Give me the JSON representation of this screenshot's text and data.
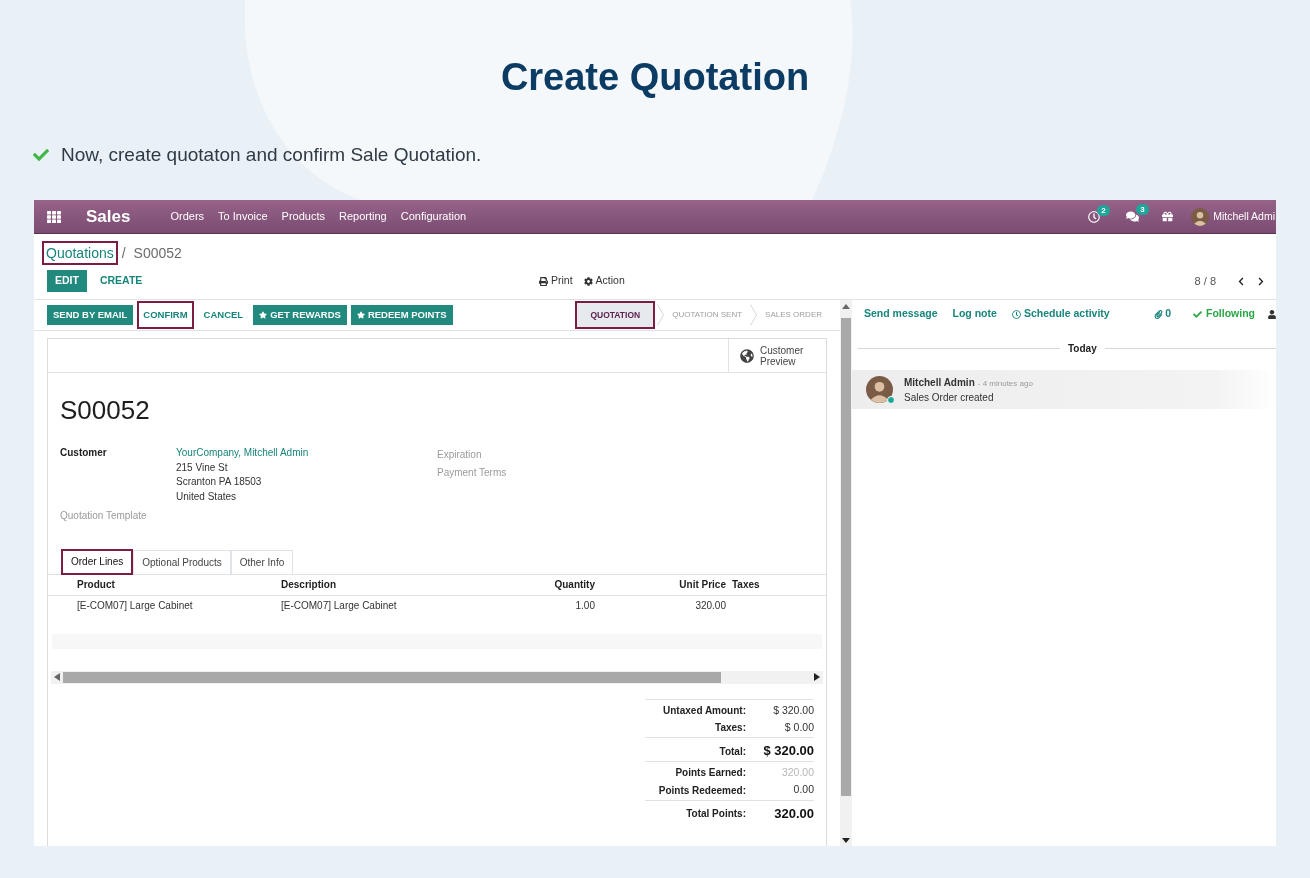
{
  "page": {
    "title": "Create Quotation",
    "note": "Now, create quotaton and confirm Sale Quotation."
  },
  "navbar": {
    "app": "Sales",
    "menu": [
      "Orders",
      "To Invoice",
      "Products",
      "Reporting",
      "Configuration"
    ],
    "activities_badge": "2",
    "messages_badge": "3",
    "user": "Mitchell Admi"
  },
  "breadcrumb": {
    "items": [
      {
        "label": "Quotations",
        "kind": "link",
        "highlighted": true
      },
      {
        "label": "S00052",
        "kind": "current",
        "highlighted": false
      }
    ],
    "separator": "/"
  },
  "toolbar": {
    "buttons": [
      {
        "label": "EDIT",
        "kind": "primary"
      },
      {
        "label": "CREATE",
        "kind": "link"
      }
    ],
    "actions": [
      "Print",
      "Action"
    ],
    "pager": "8 / 8"
  },
  "header": {
    "buttons": [
      {
        "label": "SEND BY EMAIL",
        "kind": "primary",
        "highlighted": false
      },
      {
        "label": "CONFIRM",
        "kind": "link",
        "highlighted": true
      },
      {
        "label": "CANCEL",
        "kind": "link",
        "highlighted": false
      },
      {
        "label": "GET REWARDS",
        "kind": "reward",
        "highlighted": false
      },
      {
        "label": "REDEEM POINTS",
        "kind": "reward",
        "highlighted": false
      }
    ],
    "statuses": [
      {
        "label": "QUOTATION",
        "selected": true,
        "highlighted": true
      },
      {
        "label": "QUOTATION SENT",
        "selected": false,
        "highlighted": false
      },
      {
        "label": "SALES ORDER",
        "selected": false,
        "highlighted": false
      }
    ]
  },
  "form": {
    "smart_button": "Customer Preview",
    "name": "S00052",
    "left_fields": [
      {
        "label": "Customer",
        "required": true,
        "link": "YourCompany, Mitchell Admin",
        "lines": [
          "215 Vine St",
          "Scranton PA 18503",
          "United States"
        ]
      },
      {
        "label": "Quotation Template",
        "required": false
      }
    ],
    "right_fields": [
      {
        "label": "Expiration",
        "required": false
      },
      {
        "label": "Payment Terms",
        "required": false
      }
    ]
  },
  "tabs": [
    {
      "label": "Order Lines",
      "selected": true,
      "highlighted": true
    },
    {
      "label": "Optional Products",
      "selected": false,
      "highlighted": false
    },
    {
      "label": "Other Info",
      "selected": false,
      "highlighted": false
    }
  ],
  "order_lines": {
    "columns": [
      {
        "label": "Product",
        "kind": "text"
      },
      {
        "label": "Description",
        "kind": "text"
      },
      {
        "label": "Quantity",
        "kind": "number"
      },
      {
        "label": "Unit Price",
        "kind": "number"
      },
      {
        "label": "Taxes",
        "kind": "text"
      }
    ],
    "rows": [
      {
        "cells": [
          "[E-COM07] Large Cabinet",
          "[E-COM07] Large Cabinet",
          "1.00",
          "320.00"
        ]
      }
    ]
  },
  "totals": [
    {
      "label": "Untaxed Amount:",
      "value": "$ 320.00",
      "kind": "normal"
    },
    {
      "label": "Taxes:",
      "value": "$ 0.00",
      "kind": "normal"
    },
    {
      "label": "Total:",
      "value": "$ 320.00",
      "kind": "total"
    },
    {
      "label": "Points Earned:",
      "value": "320.00",
      "kind": "muted"
    },
    {
      "label": "Points Redeemed:",
      "value": "0.00",
      "kind": "normal"
    },
    {
      "label": "Total Points:",
      "value": "320.00",
      "kind": "total"
    }
  ],
  "chatter": {
    "actions": [
      "Send message",
      "Log note",
      "Schedule activity"
    ],
    "attachments": "0",
    "follow": {
      "label": "Following",
      "following": true
    },
    "date_separator": "Today",
    "messages": [
      {
        "author": "Mitchell Admin",
        "time": "- 4 minutes ago",
        "body": "Sales Order created",
        "online": true
      }
    ]
  }
}
